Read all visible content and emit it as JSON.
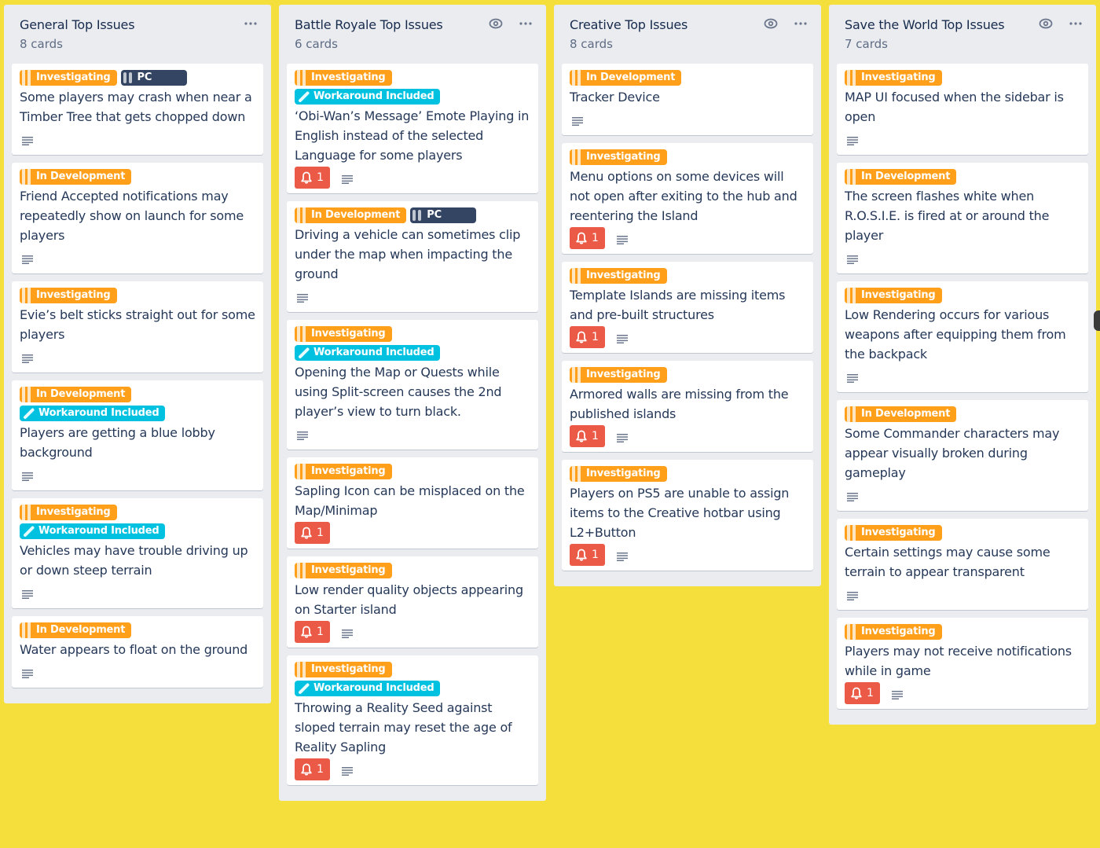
{
  "colors": {
    "background": "#f5df3d",
    "list_bg": "#ebecf0",
    "label_orange": "#ff9f1a",
    "label_navy": "#344563",
    "label_sky": "#00c2e0",
    "badge_red": "#eb5a46"
  },
  "lists": [
    {
      "title": "General Top Issues",
      "count": "8 cards",
      "watched": false,
      "cards": [
        {
          "labels": [
            {
              "text": "Investigating",
              "color": "orange"
            },
            {
              "text": "PC",
              "color": "navy"
            }
          ],
          "title": "Some players may crash when near a Timber Tree that gets chopped down",
          "notifications": null,
          "description": true
        },
        {
          "labels": [
            {
              "text": "In Development",
              "color": "orange"
            }
          ],
          "title": "Friend Accepted notifications may repeatedly show on launch for some players",
          "notifications": null,
          "description": true
        },
        {
          "labels": [
            {
              "text": "Investigating",
              "color": "orange"
            }
          ],
          "title": "Evie’s belt sticks straight out for some players",
          "notifications": null,
          "description": true
        },
        {
          "labels": [
            {
              "text": "In Development",
              "color": "orange"
            },
            {
              "text": "Workaround Included",
              "color": "sky"
            }
          ],
          "title": "Players are getting a blue lobby background",
          "notifications": null,
          "description": true
        },
        {
          "labels": [
            {
              "text": "Investigating",
              "color": "orange"
            },
            {
              "text": "Workaround Included",
              "color": "sky"
            }
          ],
          "title": "Vehicles may have trouble driving up or down steep terrain",
          "notifications": null,
          "description": true
        },
        {
          "labels": [
            {
              "text": "In Development",
              "color": "orange"
            }
          ],
          "title": "Water appears to float on the ground",
          "notifications": null,
          "description": true
        }
      ]
    },
    {
      "title": "Battle Royale Top Issues",
      "count": "6 cards",
      "watched": true,
      "cards": [
        {
          "labels": [
            {
              "text": "Investigating",
              "color": "orange"
            },
            {
              "text": "Workaround Included",
              "color": "sky"
            }
          ],
          "title": "‘Obi-Wan’s Message’ Emote Playing in English instead of the selected Language for some players",
          "notifications": "1",
          "description": true
        },
        {
          "labels": [
            {
              "text": "In Development",
              "color": "orange"
            },
            {
              "text": "PC",
              "color": "navy"
            }
          ],
          "title": "Driving a vehicle can sometimes clip under the map when impacting the ground",
          "notifications": null,
          "description": true
        },
        {
          "labels": [
            {
              "text": "Investigating",
              "color": "orange"
            },
            {
              "text": "Workaround Included",
              "color": "sky"
            }
          ],
          "title": "Opening the Map or Quests while using Split-screen causes the 2nd player’s view to turn black.",
          "notifications": null,
          "description": true
        },
        {
          "labels": [
            {
              "text": "Investigating",
              "color": "orange"
            }
          ],
          "title": "Sapling Icon can be misplaced on the Map/Minimap",
          "notifications": "1",
          "description": false
        },
        {
          "labels": [
            {
              "text": "Investigating",
              "color": "orange"
            }
          ],
          "title": "Low render quality objects appearing on Starter island",
          "notifications": "1",
          "description": true
        },
        {
          "labels": [
            {
              "text": "Investigating",
              "color": "orange"
            },
            {
              "text": "Workaround Included",
              "color": "sky"
            }
          ],
          "title": "Throwing a Reality Seed against sloped terrain may reset the age of Reality Sapling",
          "notifications": "1",
          "description": true
        }
      ]
    },
    {
      "title": "Creative Top Issues",
      "count": "8 cards",
      "watched": true,
      "cards": [
        {
          "labels": [
            {
              "text": "In Development",
              "color": "orange"
            }
          ],
          "title": "Tracker Device",
          "notifications": null,
          "description": true
        },
        {
          "labels": [
            {
              "text": "Investigating",
              "color": "orange"
            }
          ],
          "title": "Menu options on some devices will not open after exiting to the hub and reentering the Island",
          "notifications": "1",
          "description": true
        },
        {
          "labels": [
            {
              "text": "Investigating",
              "color": "orange"
            }
          ],
          "title": "Template Islands are missing items and pre-built structures",
          "notifications": "1",
          "description": true
        },
        {
          "labels": [
            {
              "text": "Investigating",
              "color": "orange"
            }
          ],
          "title": "Armored walls are missing from the published islands",
          "notifications": "1",
          "description": true
        },
        {
          "labels": [
            {
              "text": "Investigating",
              "color": "orange"
            }
          ],
          "title": "Players on PS5 are unable to assign items to the Creative hotbar using L2+Button",
          "notifications": "1",
          "description": true
        }
      ]
    },
    {
      "title": "Save the World Top Issues",
      "count": "7 cards",
      "watched": true,
      "cards": [
        {
          "labels": [
            {
              "text": "Investigating",
              "color": "orange"
            }
          ],
          "title": "MAP UI focused when the sidebar is open",
          "notifications": null,
          "description": true
        },
        {
          "labels": [
            {
              "text": "In Development",
              "color": "orange"
            }
          ],
          "title": "The screen flashes white when R.O.S.I.E. is fired at or around the player",
          "notifications": null,
          "description": true
        },
        {
          "labels": [
            {
              "text": "Investigating",
              "color": "orange"
            }
          ],
          "title": "Low Rendering occurs for various weapons after equipping them from the backpack",
          "notifications": null,
          "description": true
        },
        {
          "labels": [
            {
              "text": "In Development",
              "color": "orange"
            }
          ],
          "title": "Some Commander characters may appear visually broken during gameplay",
          "notifications": null,
          "description": true
        },
        {
          "labels": [
            {
              "text": "Investigating",
              "color": "orange"
            }
          ],
          "title": "Certain settings may cause some terrain to appear transparent",
          "notifications": null,
          "description": true
        },
        {
          "labels": [
            {
              "text": "Investigating",
              "color": "orange"
            }
          ],
          "title": "Players may not receive notifications while in game",
          "notifications": "1",
          "description": true
        }
      ]
    }
  ]
}
